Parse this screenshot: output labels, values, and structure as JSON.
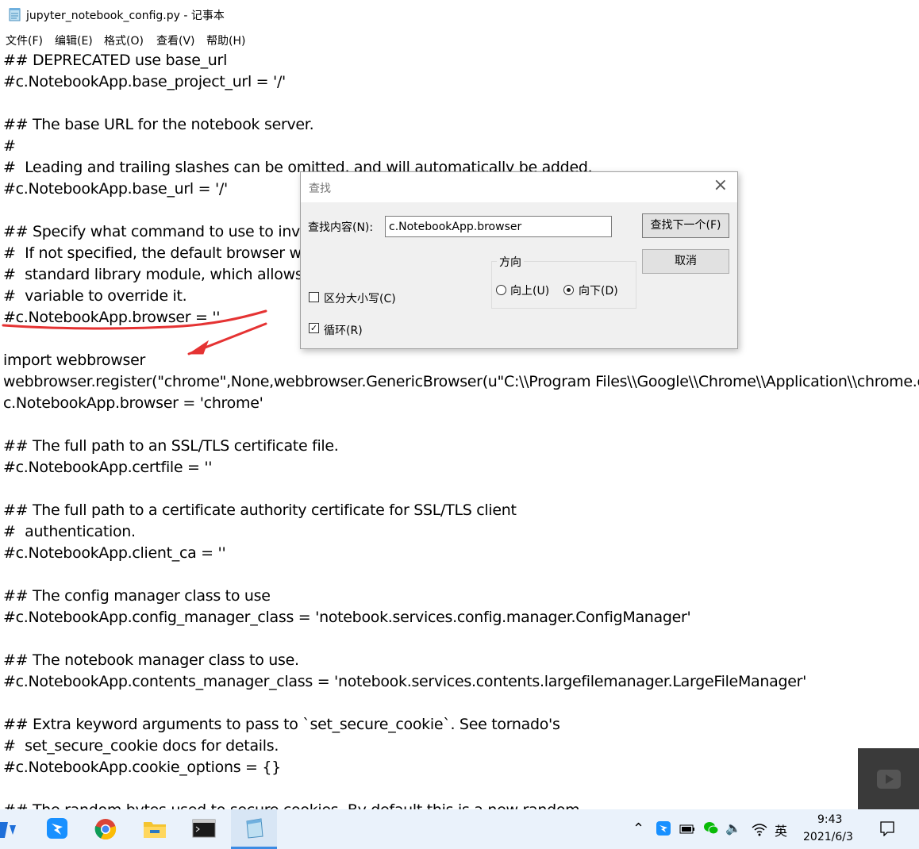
{
  "window": {
    "title": "jupyter_notebook_config.py - 记事本"
  },
  "menu": [
    "文件(F)",
    "编辑(E)",
    "格式(O)",
    "查看(V)",
    "帮助(H)"
  ],
  "editor": {
    "lines": [
      "## DEPRECATED use base_url",
      "#c.NotebookApp.base_project_url = '/'",
      "",
      "## The base URL for the notebook server.",
      "#",
      "#  Leading and trailing slashes can be omitted, and will automatically be added.",
      "#c.NotebookApp.base_url = '/'",
      "",
      "## Specify what command to use to invoke a web browser when opening the notebook.",
      "#  If not specified, the default browser will be determined by the `webbrowser`",
      "#  standard library module, which allows setting of the BROWSER environment",
      "#  variable to override it.",
      "#c.NotebookApp.browser = ''",
      "",
      "import webbrowser",
      "webbrowser.register(\"chrome\",None,webbrowser.GenericBrowser(u\"C:\\\\Program Files\\\\Google\\\\Chrome\\\\Application\\\\chrome.exe\"))",
      "c.NotebookApp.browser = 'chrome'",
      "",
      "## The full path to an SSL/TLS certificate file.",
      "#c.NotebookApp.certfile = ''",
      "",
      "## The full path to a certificate authority certificate for SSL/TLS client",
      "#  authentication.",
      "#c.NotebookApp.client_ca = ''",
      "",
      "## The config manager class to use",
      "#c.NotebookApp.config_manager_class = 'notebook.services.config.manager.ConfigManager'",
      "",
      "## The notebook manager class to use.",
      "#c.NotebookApp.contents_manager_class = 'notebook.services.contents.largefilemanager.LargeFileManager'",
      "",
      "## Extra keyword arguments to pass to `set_secure_cookie`. See tornado's",
      "#  set_secure_cookie docs for details.",
      "#c.NotebookApp.cookie_options = {}",
      "",
      "## The random bytes used to secure cookies. By default this is a new random"
    ]
  },
  "find_dialog": {
    "title": "查找",
    "find_label": "查找内容(N):",
    "find_value": "c.NotebookApp.browser",
    "find_next_button": "查找下一个(F)",
    "cancel_button": "取消",
    "direction_label": "方向",
    "up_label": "向上(U)",
    "down_label": "向下(D)",
    "direction_selected": "down",
    "match_case_label": "区分大小写(C)",
    "match_case_checked": false,
    "wrap_label": "循环(R)",
    "wrap_checked": true
  },
  "annotation": {
    "color": "#e53333"
  },
  "taskbar": {
    "clock_time": "9:43",
    "clock_date": "2021/6/3",
    "ime": "英"
  }
}
